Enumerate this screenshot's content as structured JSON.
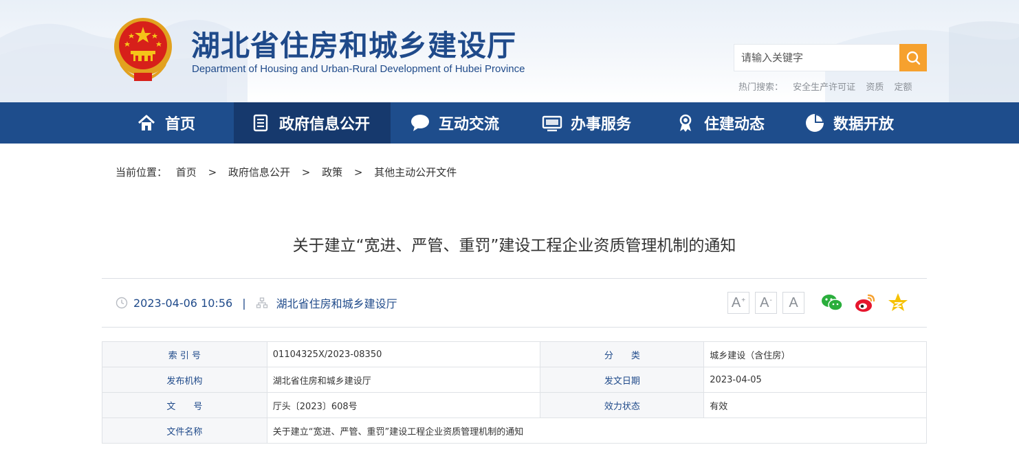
{
  "header": {
    "title": "湖北省住房和城乡建设厅",
    "subtitle": "Department of Housing and Urban-Rural Development of Hubei Province",
    "emblem_icon": "national-emblem-icon"
  },
  "search": {
    "placeholder": "请输入关键字",
    "button_icon": "search-icon",
    "hot_label": "热门搜索：",
    "hot_terms": [
      "安全生产许可证",
      "资质",
      "定额"
    ]
  },
  "nav": {
    "items": [
      {
        "label": "首页",
        "icon": "home-icon"
      },
      {
        "label": "政府信息公开",
        "icon": "document-list-icon",
        "active": true
      },
      {
        "label": "互动交流",
        "icon": "chat-bubble-icon"
      },
      {
        "label": "办事服务",
        "icon": "monitor-icon"
      },
      {
        "label": "住建动态",
        "icon": "medal-icon"
      },
      {
        "label": "数据开放",
        "icon": "pie-chart-icon"
      }
    ]
  },
  "breadcrumb": {
    "label": "当前位置：",
    "separator": ">",
    "items": [
      "首页",
      "政府信息公开",
      "政策",
      "其他主动公开文件"
    ]
  },
  "article": {
    "title": "关于建立“宽进、严管、重罚”建设工程企业资质管理机制的通知",
    "datetime": "2023-04-06 10:56",
    "divider": "|",
    "source": "湖北省住房和城乡建设厅"
  },
  "font_size": {
    "larger": "A",
    "larger_mark": "+",
    "smaller": "A",
    "smaller_mark": "-",
    "reset": "A"
  },
  "share": [
    "wechat-icon",
    "weibo-icon",
    "qzone-icon"
  ],
  "info_table": {
    "index_label": "索 引 号",
    "index_value": "01104325X/2023-08350",
    "category_label": "分　　类",
    "category_value": "城乡建设（含住房）",
    "publisher_label": "发布机构",
    "publisher_value": "湖北省住房和城乡建设厅",
    "issue_date_label": "发文日期",
    "issue_date_value": "2023-04-05",
    "doc_no_label": "文　　号",
    "doc_no_value": "厅头〔2023〕608号",
    "validity_label": "效力状态",
    "validity_value": "有效",
    "doc_name_label": "文件名称",
    "doc_name_value": "关于建立“宽进、严管、重罚”建设工程企业资质管理机制的通知"
  },
  "colors": {
    "brand_blue": "#1e4d8c",
    "nav_active": "#16396d",
    "search_orange": "#f6a12e",
    "share_green": "#2aae3c",
    "share_weibo": "#e6162d",
    "share_qzone": "#f6c100"
  }
}
